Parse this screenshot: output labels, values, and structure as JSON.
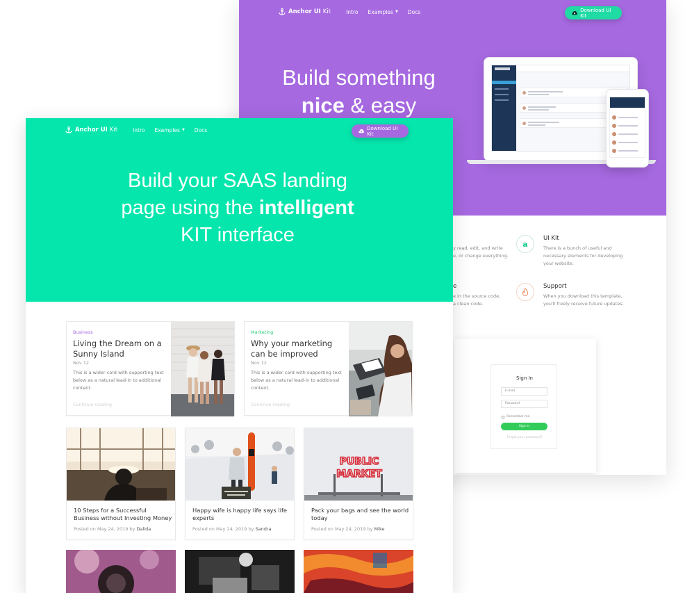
{
  "back_page": {
    "brand": {
      "name": "Anchor UI",
      "suffix": "Kit"
    },
    "nav": {
      "intro": "Intro",
      "examples": "Examples",
      "docs": "Docs"
    },
    "download_label": "Download UI Kit",
    "headline": {
      "line1": "Build something",
      "line2_bold": "nice",
      "line2_rest": "& easy"
    },
    "features": [
      {
        "title": "UI Kit",
        "text": "There is a bunch of useful and necessary elements for developing your website.",
        "icon": "a"
      },
      {
        "title": "Support",
        "text": "When you download this template, you'll freely receive future updates.",
        "icon": "flame-icon"
      }
    ],
    "partial_texts": {
      "line1": "y read, edit, and write",
      "line2": "e, or change everything.",
      "title2": "e",
      "line3": "e in the source code,",
      "line4": "a clean code."
    },
    "signin": {
      "title": "Sign In",
      "email_placeholder": "E-mail",
      "password_placeholder": "Password",
      "remember": "Remember me",
      "button": "Sign in",
      "forgot": "Forgot your password?"
    },
    "colors": {
      "hero": "#a669e0",
      "button": "#20dba4"
    }
  },
  "front_page": {
    "brand": {
      "name": "Anchor UI",
      "suffix": "Kit"
    },
    "nav": {
      "intro": "Intro",
      "examples": "Examples",
      "docs": "Docs"
    },
    "download_label": "Download UI Kit",
    "headline": {
      "line1": "Build your SAAS landing",
      "line2_regular": "page using the",
      "line2_bold": "intelligent",
      "line3": "KIT interface"
    },
    "wide_cards": [
      {
        "category": "Business",
        "category_color": "#a669e0",
        "title": "Living the Dream on a Sunny Island",
        "date": "Nov 12",
        "text": "This is a wider card with supporting text below as a natural lead-in to additional content.",
        "more": "Continue reading"
      },
      {
        "category": "Marketing",
        "category_color": "#2ccf7a",
        "title": "Why your marketing can be improved",
        "date": "Nov 12",
        "text": "This is a wider card with supporting text below as a natural lead-in to additional content.",
        "more": "Continue reading"
      }
    ],
    "small_cards": [
      {
        "title": "10 Steps for a Successful Business without Investing Money",
        "meta_prefix": "Posted on May 24, 2019 by",
        "author": "Dalida"
      },
      {
        "title": "Happy wife is happy life says life experts",
        "meta_prefix": "Posted on May 24, 2019 by",
        "author": "Sandra"
      },
      {
        "title": "Pack your bags and see the world today",
        "meta_prefix": "Posted on May 24, 2019 by",
        "author": "Mike"
      }
    ],
    "sign_text": {
      "line1": "PUBLIC",
      "line2": "MARKET"
    },
    "colors": {
      "hero": "#05e6ad",
      "button": "#a669e0"
    }
  }
}
